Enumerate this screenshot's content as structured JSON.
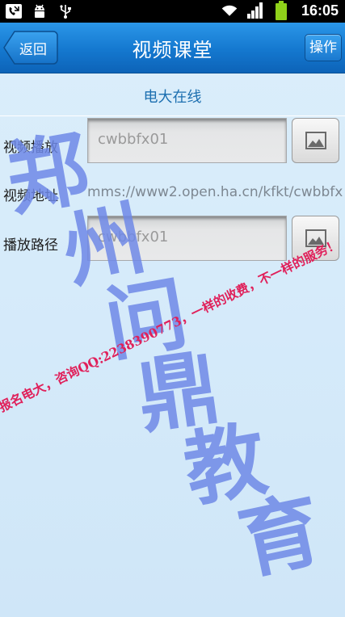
{
  "status_bar": {
    "time": "16:05",
    "icons": [
      "missed-call-icon",
      "android-debug-icon",
      "usb-icon",
      "wifi-icon",
      "signal-icon",
      "battery-icon"
    ]
  },
  "header": {
    "back_label": "返回",
    "title": "视频课堂",
    "action_label": "操作"
  },
  "section": {
    "title": "电大在线"
  },
  "form": {
    "rows": [
      {
        "label": "视频播放",
        "value": "cwbbfx01"
      },
      {
        "label": "视频地址",
        "value": "mms://www2.open.ha.cn/kfkt/cwbbfx"
      },
      {
        "label": "播放路径",
        "value": "cwbbfx01"
      }
    ]
  },
  "watermark": {
    "big_text": [
      "郑",
      "州",
      "问",
      "鼎",
      "教",
      "育"
    ],
    "line_text": "报名电大，咨询QQ:2238390773，一样的收费，不一样的服务！"
  },
  "colors": {
    "header": "#1478cf",
    "watermark_blue": "#6f88e6",
    "watermark_red": "#e0205a"
  }
}
